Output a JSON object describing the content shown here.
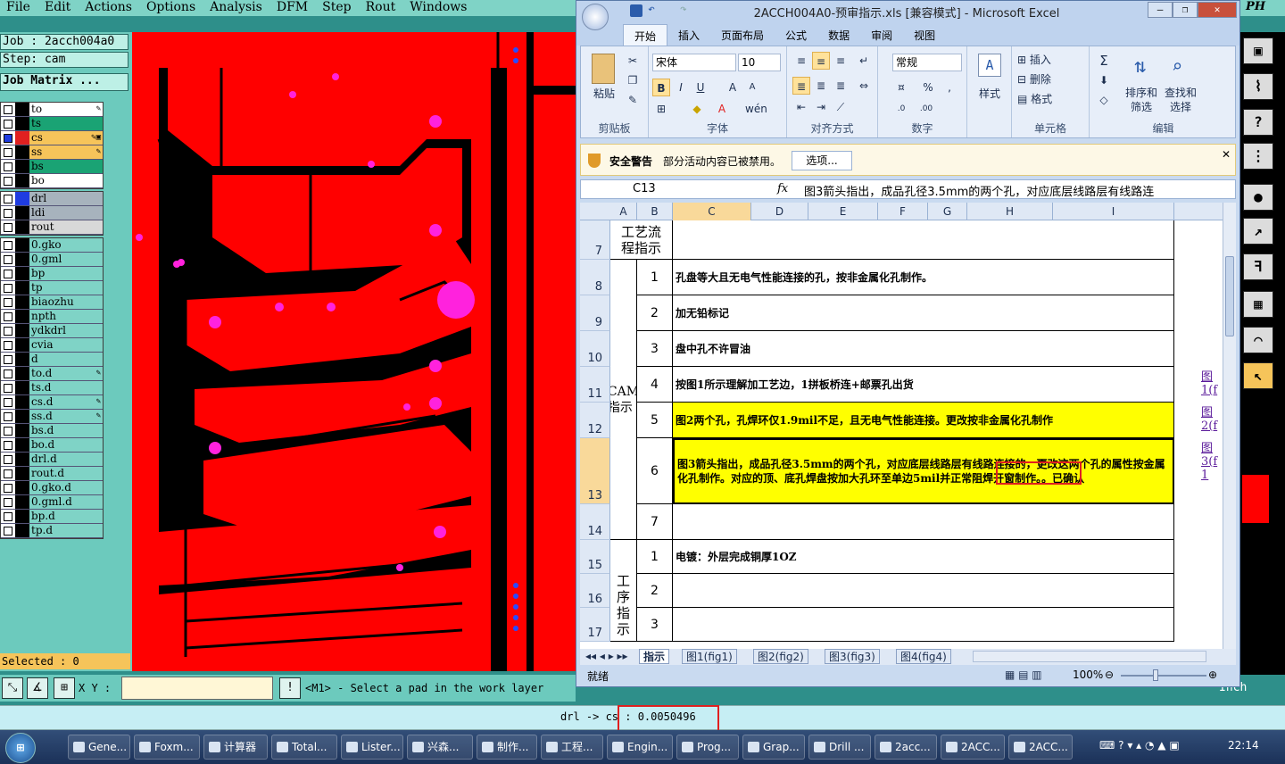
{
  "genesis": {
    "menu": [
      "File",
      "Edit",
      "Actions",
      "Options",
      "Analysis",
      "DFM",
      "Step",
      "Rout",
      "Windows"
    ],
    "right_menu": "PH",
    "job": "Job : 2acch004a0",
    "step": "Step: cam",
    "job_matrix": "Job Matrix ...",
    "layers_top": [
      {
        "name": "to",
        "color": "#ffffff",
        "sw": "#000000",
        "mark": "✎"
      },
      {
        "name": "ts",
        "color": "#1aa374",
        "sw": "#000000",
        "mark": ""
      },
      {
        "name": "cs",
        "color": "#f6c45a",
        "sw": "#e02020",
        "mark": "✎▣",
        "active": true
      },
      {
        "name": "ss",
        "color": "#f6c45a",
        "sw": "#000000",
        "mark": "✎"
      },
      {
        "name": "bs",
        "color": "#1aa374",
        "sw": "#000000",
        "mark": ""
      },
      {
        "name": "bo",
        "color": "#ffffff",
        "sw": "#000000",
        "mark": ""
      }
    ],
    "layers_drill": [
      {
        "name": "drl",
        "color": "#a7b3bd",
        "sw": "#1f3ce0",
        "mark": ""
      },
      {
        "name": "ldi",
        "color": "#a7b3bd",
        "sw": "#000000",
        "mark": ""
      },
      {
        "name": "rout",
        "color": "#d8d8d8",
        "sw": "#000000",
        "mark": ""
      }
    ],
    "layers_misc": [
      {
        "name": "0.gko",
        "mark": ""
      },
      {
        "name": "0.gml",
        "mark": ""
      },
      {
        "name": "bp",
        "mark": ""
      },
      {
        "name": "tp",
        "mark": ""
      },
      {
        "name": "biaozhu",
        "mark": ""
      },
      {
        "name": "npth",
        "mark": ""
      },
      {
        "name": "ydkdrl",
        "mark": ""
      },
      {
        "name": "cvia",
        "mark": ""
      },
      {
        "name": "d",
        "mark": ""
      },
      {
        "name": "to.d",
        "mark": "✎"
      },
      {
        "name": "ts.d",
        "mark": ""
      },
      {
        "name": "cs.d",
        "mark": "✎"
      },
      {
        "name": "ss.d",
        "mark": "✎"
      },
      {
        "name": "bs.d",
        "mark": ""
      },
      {
        "name": "bo.d",
        "mark": ""
      },
      {
        "name": "drl.d",
        "mark": ""
      },
      {
        "name": "rout.d",
        "mark": ""
      },
      {
        "name": "0.gko.d",
        "mark": ""
      },
      {
        "name": "0.gml.d",
        "mark": ""
      },
      {
        "name": "bp.d",
        "mark": ""
      },
      {
        "name": "tp.d",
        "mark": ""
      }
    ],
    "selected": "Selected : 0",
    "xy_label": "X Y :",
    "xy_value": "",
    "message": "<M1> - Select a pad in the work layer",
    "measure": "drl -> cs : 0.0050496",
    "unit": "Inch",
    "colors": {
      "copper": "#ff0000",
      "pad": "#ff22dd",
      "via": "#2a4bff",
      "bg": "#000000"
    }
  },
  "excel": {
    "title": "2ACCH004A0-预审指示.xls [兼容模式] - Microsoft Excel",
    "tabs": [
      "开始",
      "插入",
      "页面布局",
      "公式",
      "数据",
      "审阅",
      "视图"
    ],
    "groups": {
      "clipboard": "剪贴板",
      "font": "字体",
      "align": "对齐方式",
      "number": "数字",
      "cells": "单元格",
      "edit": "编辑"
    },
    "paste": "粘贴",
    "font_name": "宋体",
    "font_size": "10",
    "number_format": "常规",
    "style_label": "样式",
    "cells_btns": [
      "插入",
      "删除",
      "格式"
    ],
    "edit_btns": [
      "排序和筛选",
      "查找和选择"
    ],
    "security_label": "安全警告",
    "security_text": "部分活动内容已被禁用。",
    "security_btn": "选项...",
    "name_box": "C13",
    "formula": "图3箭头指出，成品孔径3.5mm的两个孔，对应底层线路层有线路连",
    "columns": [
      "A",
      "B",
      "C",
      "D",
      "E",
      "F",
      "G",
      "H",
      "I"
    ],
    "rows": [
      "7",
      "8",
      "9",
      "10",
      "11",
      "12",
      "13",
      "14",
      "15",
      "16",
      "17"
    ],
    "section_process": "工艺流程指示",
    "section_cam": "CAM指示",
    "section_step": "工序指示",
    "cam_items": [
      {
        "n": "1",
        "text": "孔盘等大且无电气性能连接的孔，按非金属化孔制作。"
      },
      {
        "n": "2",
        "text": "加无铅标记"
      },
      {
        "n": "3",
        "text": "盘中孔不许冒油"
      },
      {
        "n": "4",
        "text": "按图1所示理解加工艺边，1拼板桥连+邮票孔出货"
      },
      {
        "n": "5",
        "text": "图2两个孔，孔焊环仅1.9mil不足，且无电气性能连接。更改按非金属化孔制作"
      },
      {
        "n": "6",
        "text": "图3箭头指出，成品孔径3.5mm的两个孔，对应底层线路层有线路连接的，更改这两个孔的属性按金属化孔制作。对应的顶、底孔焊盘按加大孔环至单边5mil并正常阻焊开窗制作。。已确认"
      },
      {
        "n": "7",
        "text": ""
      }
    ],
    "step_items": [
      {
        "n": "1",
        "text": "电镀：外层完成铜厚1OZ"
      },
      {
        "n": "2",
        "text": ""
      },
      {
        "n": "3",
        "text": ""
      }
    ],
    "links": [
      "图1(f",
      "图2(f",
      "图3(f1"
    ],
    "sheets": [
      "指示",
      "图1(fig1)",
      "图2(fig2)",
      "图3(fig3)",
      "图4(fig4)"
    ],
    "status": "就绪",
    "zoom": "100%",
    "highlight_color": "#ffff00"
  },
  "taskbar": {
    "items": [
      "Gene...",
      "Foxm...",
      "计算器",
      "Total...",
      "Lister...",
      "兴森...",
      "制作...",
      "工程...",
      "Engin...",
      "Prog...",
      "Grap...",
      "Drill ...",
      "2acc...",
      "2ACC...",
      "2ACC..."
    ],
    "clock": "22:14"
  }
}
